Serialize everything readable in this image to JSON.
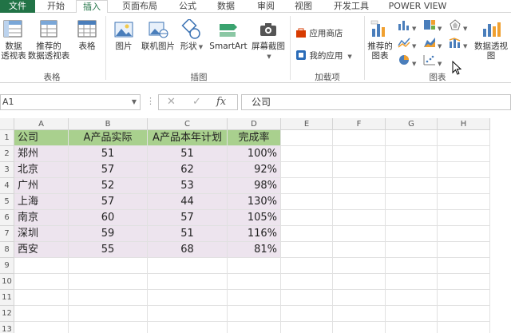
{
  "tabs": [
    {
      "label": "文件",
      "active": false,
      "file": true
    },
    {
      "label": "开始",
      "active": false
    },
    {
      "label": "插入",
      "active": true
    },
    {
      "label": "页面布局",
      "active": false
    },
    {
      "label": "公式",
      "active": false
    },
    {
      "label": "数据",
      "active": false
    },
    {
      "label": "审阅",
      "active": false
    },
    {
      "label": "视图",
      "active": false
    },
    {
      "label": "开发工具",
      "active": false
    },
    {
      "label": "POWER VIEW",
      "active": false
    }
  ],
  "ribbon": {
    "tables": {
      "pivot_l1": "数据",
      "pivot_l2": "透视表",
      "rec_pivot_l1": "推荐的",
      "rec_pivot_l2": "数据透视表",
      "table": "表格",
      "group_label": "表格"
    },
    "illustrations": {
      "picture": "图片",
      "online_picture": "联机图片",
      "shapes": "形状",
      "smartart": "SmartArt",
      "screenshot": "屏幕截图",
      "group_label": "插图"
    },
    "addins": {
      "store": "应用商店",
      "my_apps": "我的应用",
      "group_label": "加载项"
    },
    "charts": {
      "rec_l1": "推荐的",
      "rec_l2": "图表",
      "pivot_chart": "数据透视图",
      "group_label": "图表"
    }
  },
  "formula": {
    "namebox": "A1",
    "fx": "fx",
    "content": "公司"
  },
  "columns": [
    "A",
    "B",
    "C",
    "D",
    "E",
    "F",
    "G",
    "H"
  ],
  "rows": [
    "1",
    "2",
    "3",
    "4",
    "5",
    "6",
    "7",
    "8",
    "9",
    "10",
    "11",
    "12",
    "13"
  ],
  "table": {
    "header": [
      "公司",
      "A产品实际",
      "A产品本年计划",
      "完成率"
    ],
    "rows": [
      [
        "郑州",
        "51",
        "51",
        "100%"
      ],
      [
        "北京",
        "57",
        "62",
        "92%"
      ],
      [
        "广州",
        "52",
        "53",
        "98%"
      ],
      [
        "上海",
        "57",
        "44",
        "130%"
      ],
      [
        "南京",
        "60",
        "57",
        "105%"
      ],
      [
        "深圳",
        "59",
        "51",
        "116%"
      ],
      [
        "西安",
        "55",
        "68",
        "81%"
      ]
    ]
  },
  "colors": {
    "accent": "#217346",
    "header_fill": "#a9d08e",
    "data_fill": "#ede4ee"
  }
}
